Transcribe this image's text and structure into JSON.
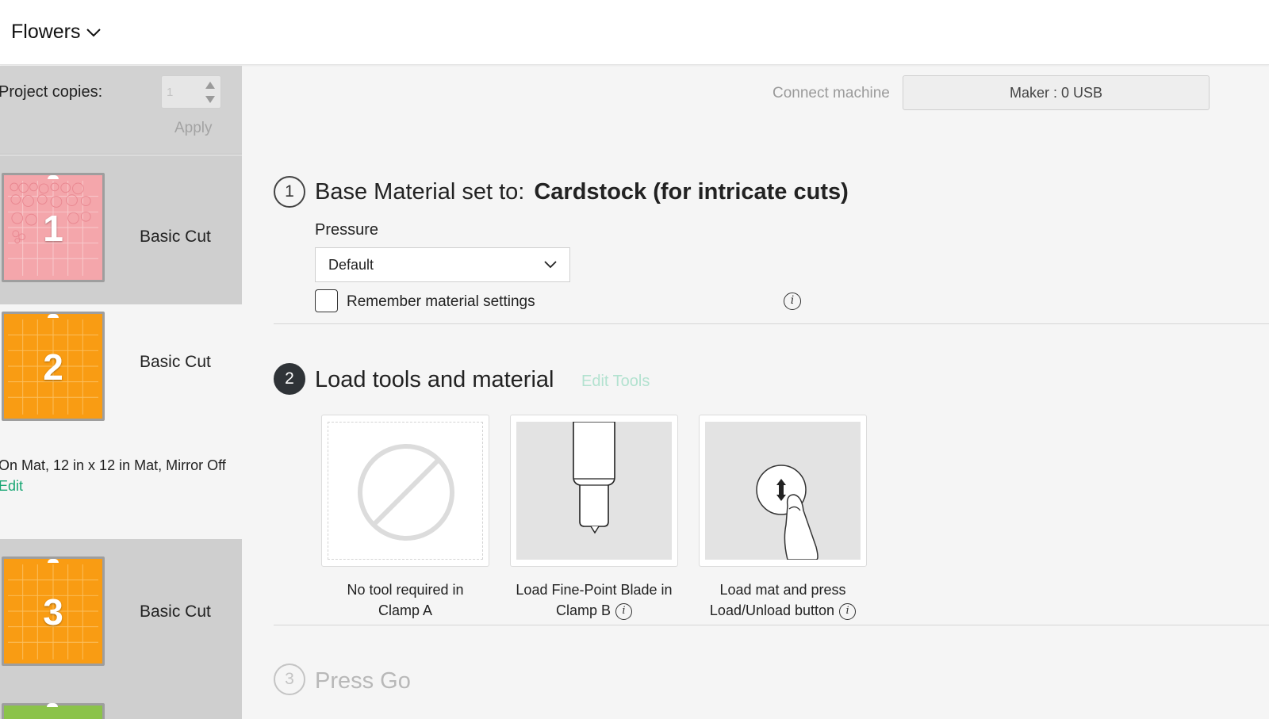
{
  "header": {
    "project_title": "Flowers"
  },
  "sidebar": {
    "copies_label": "Project copies:",
    "copies_value": "1",
    "apply_label": "Apply",
    "mats": [
      {
        "number": "1",
        "label": "Basic Cut",
        "color": "#f4a6ab"
      },
      {
        "number": "2",
        "label": "Basic Cut",
        "color": "#f99c13"
      },
      {
        "number": "3",
        "label": "Basic Cut",
        "color": "#f99c13"
      }
    ],
    "mat_details": "On Mat, 12 in x 12 in Mat, Mirror Off",
    "edit_label": "Edit"
  },
  "machine": {
    "connect_label": "Connect machine",
    "selected": "Maker : 0 USB"
  },
  "step1": {
    "number": "1",
    "prefix": "Base Material set to:",
    "material": "Cardstock (for intricate cuts)",
    "pressure_label": "Pressure",
    "pressure_value": "Default",
    "remember_label": "Remember material settings",
    "remember_checked": false
  },
  "step2": {
    "number": "2",
    "title": "Load tools and material",
    "edit_tools": "Edit Tools",
    "cards": [
      {
        "line1": "No tool required in",
        "line2": "Clamp A",
        "icon": "no-tool-icon"
      },
      {
        "line1": "Load Fine-Point Blade in",
        "line2": "Clamp B",
        "icon": "fine-point-blade-icon"
      },
      {
        "line1": "Load mat and press",
        "line2": "Load/Unload button",
        "icon": "load-unload-button-icon"
      }
    ]
  },
  "step3": {
    "number": "3",
    "title": "Press Go"
  },
  "colors": {
    "accent": "#17a673",
    "accent_light": "#b3e2d0",
    "dark_circle": "#2f3337"
  }
}
